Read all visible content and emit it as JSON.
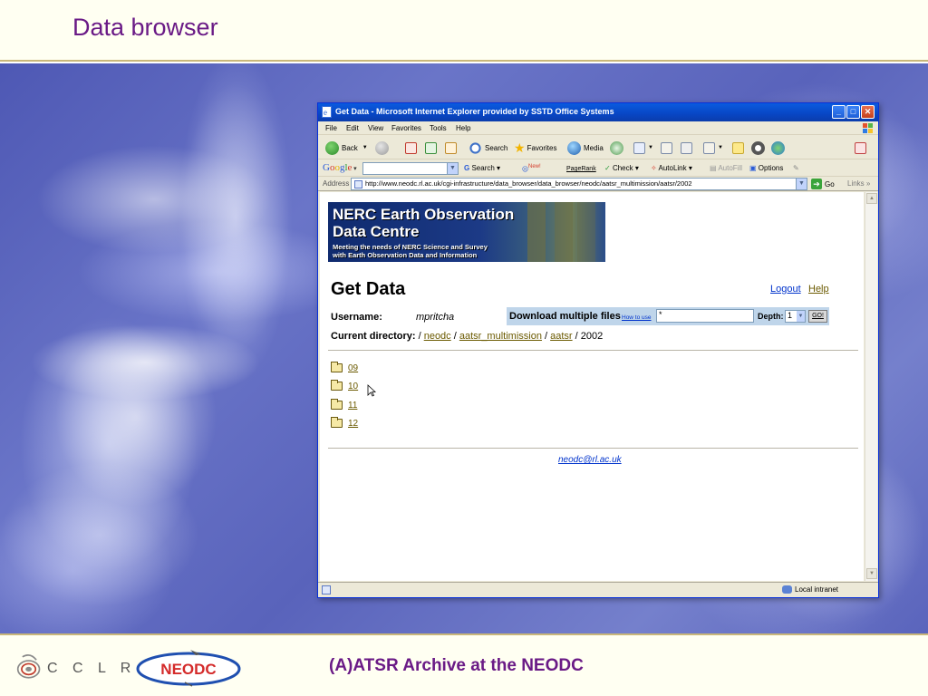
{
  "slide": {
    "title": "Data browser",
    "footer_caption": "(A)ATSR Archive at the NEODC",
    "logos": {
      "cclrc": "C C L R C",
      "neodc": "NEODC"
    }
  },
  "browser": {
    "window_title": "Get Data - Microsoft Internet Explorer provided by SSTD Office Systems",
    "menu": [
      "File",
      "Edit",
      "View",
      "Favorites",
      "Tools",
      "Help"
    ],
    "toolbar": {
      "back": "Back",
      "search": "Search",
      "favorites": "Favorites",
      "media": "Media"
    },
    "google_bar": {
      "logo": "Google",
      "search": "Search",
      "new_badge": "New!",
      "pagerank": "PageRank",
      "check": "Check",
      "autolink": "AutoLink",
      "autofill": "AutoFill",
      "options": "Options"
    },
    "address": {
      "label": "Address",
      "url": "http://www.neodc.rl.ac.uk/cgi-infrastructure/data_browser/data_browser/neodc/aatsr_multimission/aatsr/2002",
      "go": "Go",
      "links": "Links"
    },
    "status": {
      "zone": "Local intranet"
    },
    "colors": {
      "title_bar": "#0846c4",
      "link": "#0033cc",
      "visited_link": "#6b5a00",
      "panel": "#bfd5ea"
    }
  },
  "page": {
    "banner": {
      "title": "NERC Earth Observation\nData Centre",
      "subtitle": "Meeting the needs of NERC Science and Survey\nwith Earth Observation Data and Information"
    },
    "heading": "Get Data",
    "logout": "Logout",
    "help": "Help",
    "username_label": "Username:",
    "username_value": "mpritcha",
    "download": {
      "label": "Download multiple files",
      "how_to_use": "How to use",
      "pattern_value": "*",
      "depth_label": "Depth:",
      "depth_value": "1",
      "go": "GO!"
    },
    "current_dir": {
      "label": "Current directory:",
      "sep1": " / ",
      "neodc": "neodc",
      "sep2": " / ",
      "multimission": "aatsr_multimission",
      "sep3": " / ",
      "aatsr": "aatsr",
      "tail": " / 2002"
    },
    "folders": [
      "09",
      "10",
      "11",
      "12"
    ],
    "email": "neodc@rl.ac.uk"
  }
}
